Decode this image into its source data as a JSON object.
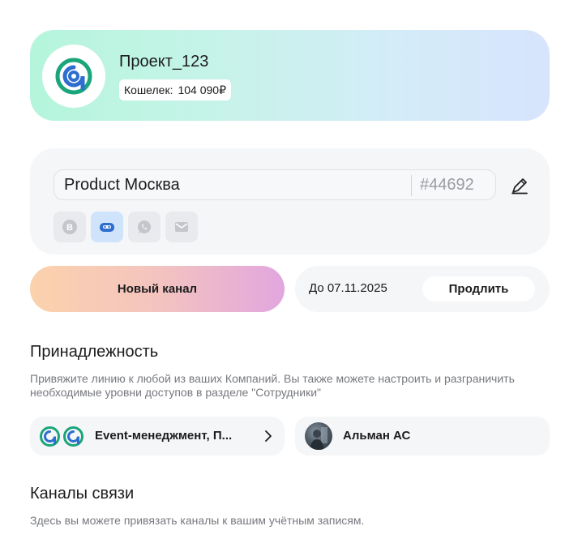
{
  "project": {
    "name": "Проект_123",
    "wallet_label": "Кошелек:",
    "wallet_value": "104 090₽",
    "logo_icon": "app-logo-icon"
  },
  "line": {
    "name": "Product Москва",
    "id": "#44692",
    "edit_icon": "pencil-icon",
    "channels": [
      {
        "icon": "viber-icon",
        "active": false
      },
      {
        "icon": "bot-icon",
        "active": true
      },
      {
        "icon": "whatsapp-icon",
        "active": false
      },
      {
        "icon": "mail-icon",
        "active": false
      }
    ]
  },
  "actions": {
    "new_channel_label": "Новый канал",
    "expiry_text": "До 07.11.2025",
    "extend_label": "Продлить"
  },
  "affiliation": {
    "title": "Принадлежность",
    "description": "Привяжите линию к любой из ваших Компаний. Вы также можете настроить и разграничить необходимые уровни доступов в разделе \"Сотрудники\"",
    "company_name": "Event-менеджмент, П...",
    "employee_name": "Альман АС"
  },
  "channels_section": {
    "title": "Каналы связи",
    "description": "Здесь вы можете привязать каналы к вашим учётным записям."
  },
  "colors": {
    "brand_green": "#1aa57a",
    "brand_blue": "#2d6ecf",
    "card_bg": "#f5f6f8",
    "muted_text": "#77797f"
  }
}
